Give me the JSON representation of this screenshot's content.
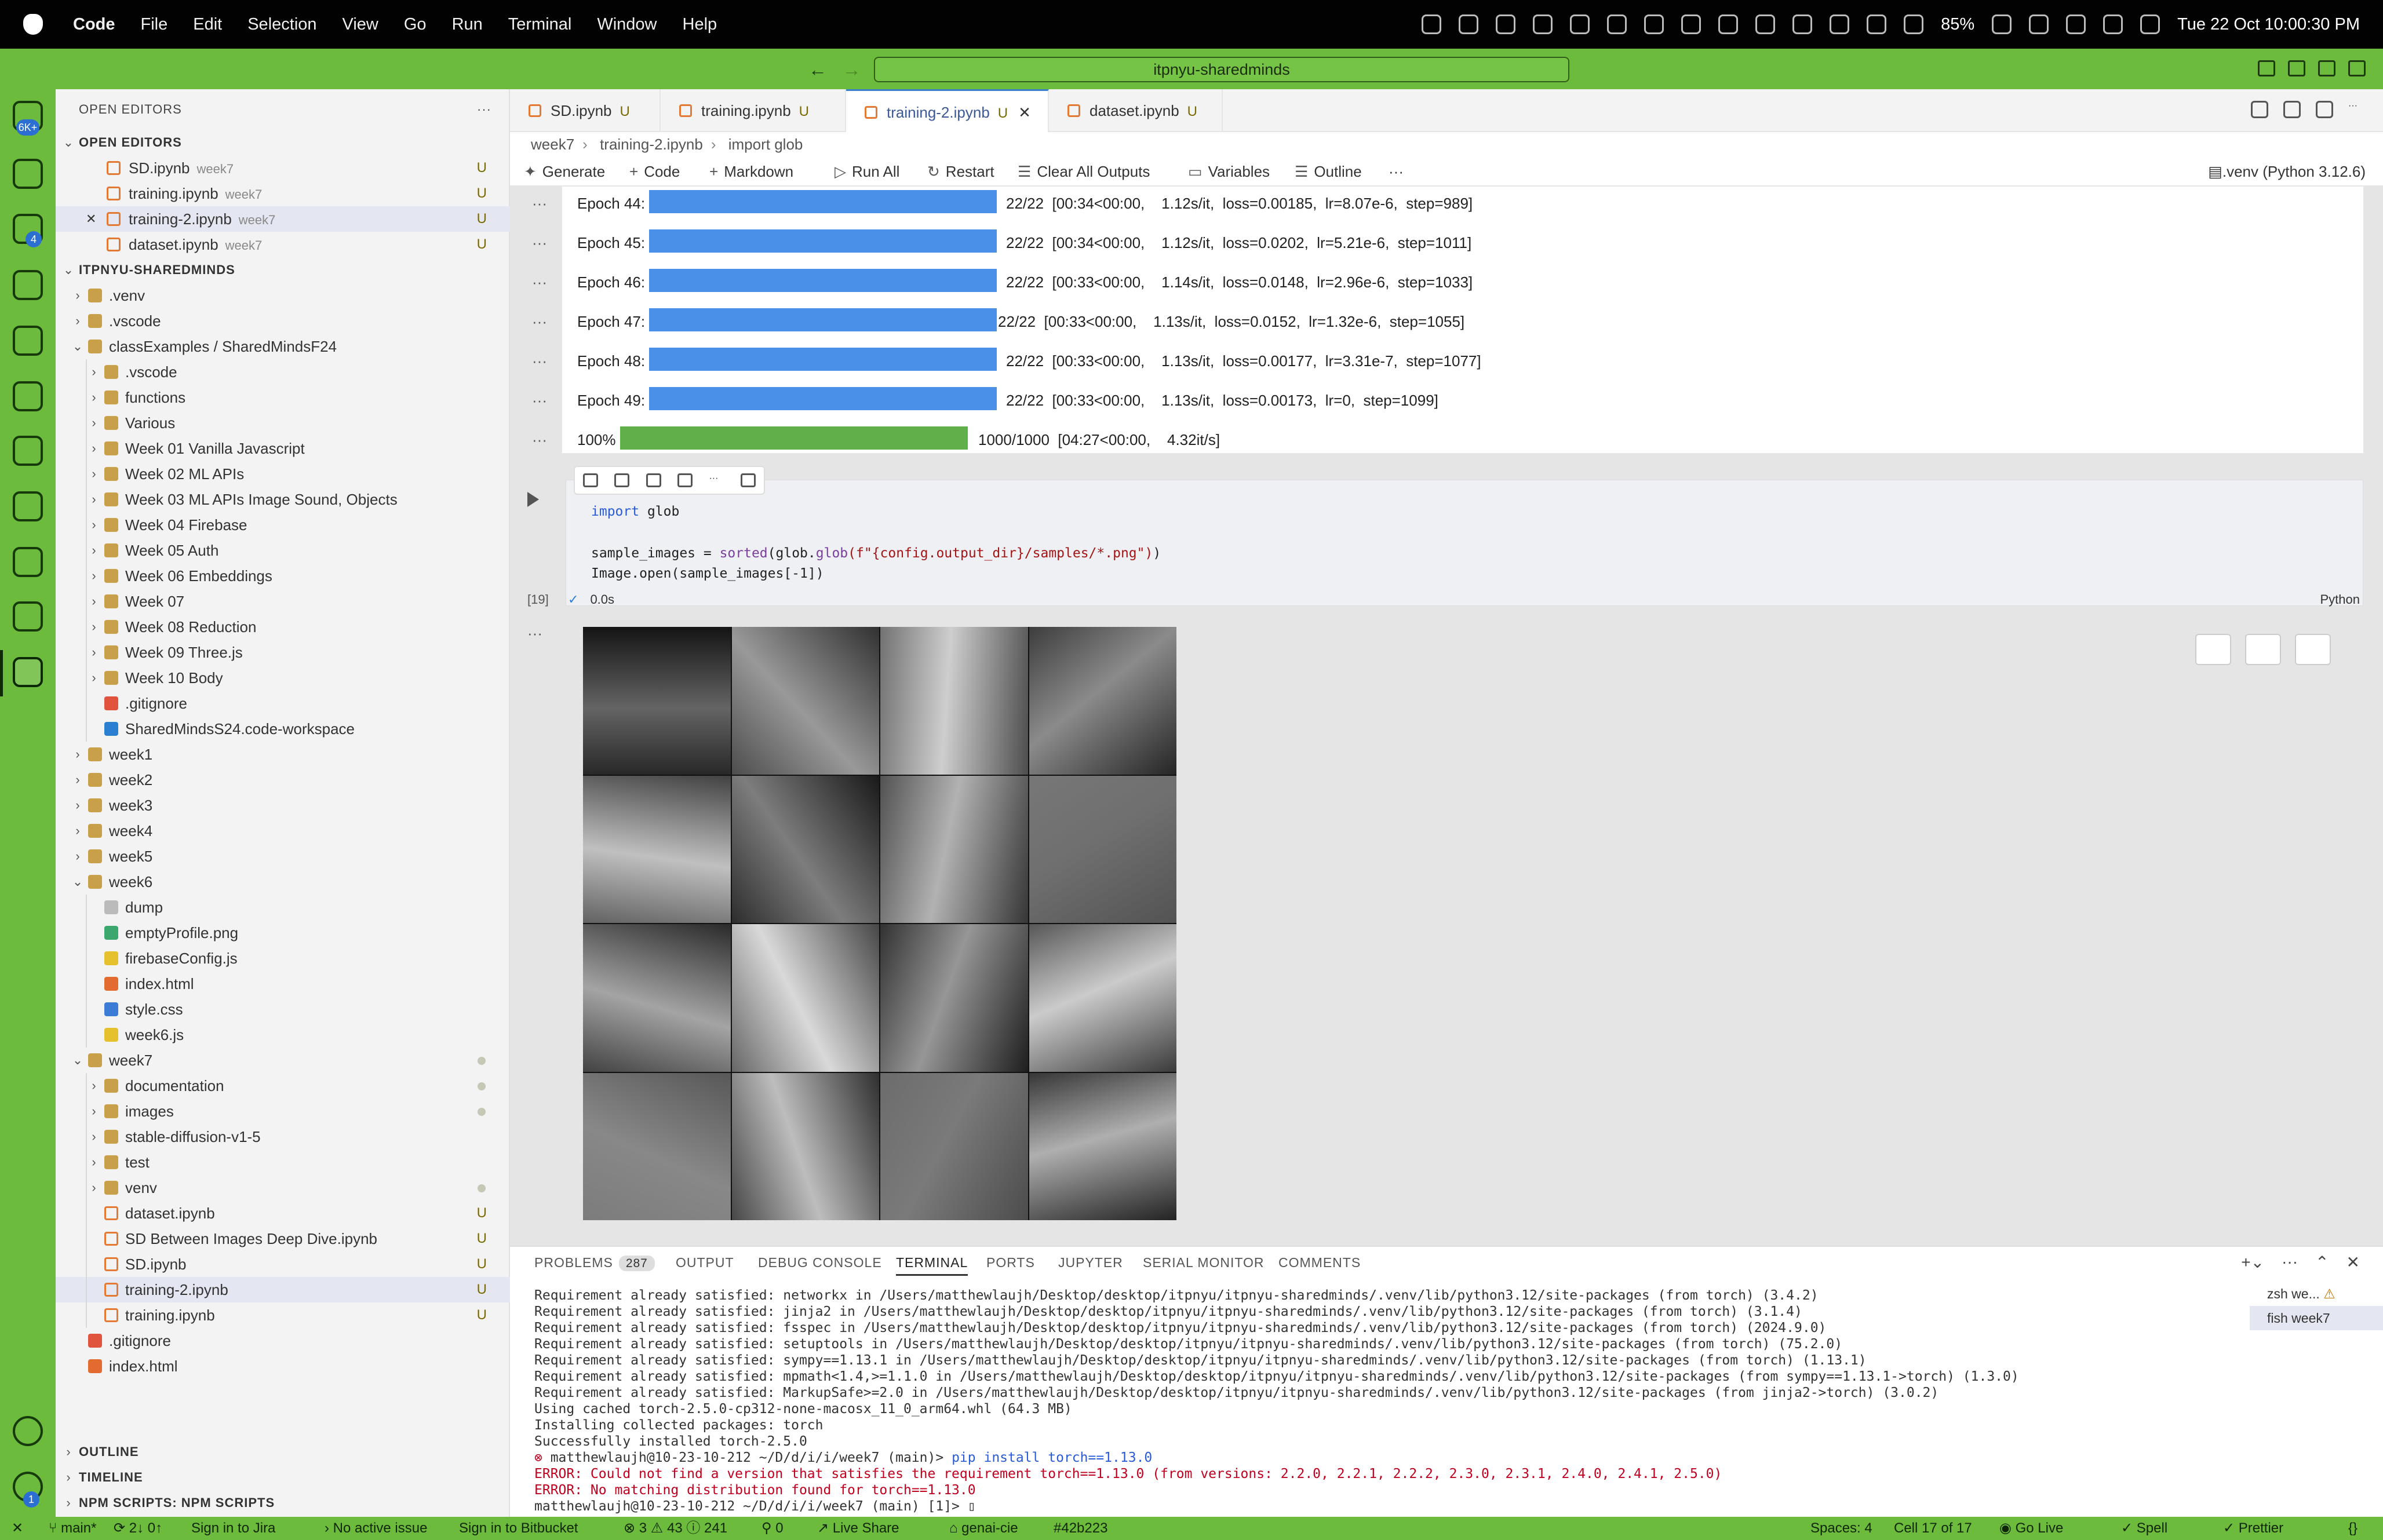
{
  "menubar": {
    "app": "Code",
    "items": [
      "File",
      "Edit",
      "Selection",
      "View",
      "Go",
      "Run",
      "Terminal",
      "Window",
      "Help"
    ],
    "battery": "85%",
    "datetime": "Tue 22 Oct  10:00:30 PM"
  },
  "titlebar": {
    "command_center": "itpnyu-sharedminds"
  },
  "activity": {
    "badge_accounts": "6K+",
    "badge_extensions": "4",
    "badge_settings": "1"
  },
  "sidebar": {
    "header": "OPEN EDITORS",
    "open_editors_title": "OPEN EDITORS",
    "open_editors": [
      {
        "name": "SD.ipynb",
        "desc": "week7",
        "status": "U"
      },
      {
        "name": "training.ipynb",
        "desc": "week7",
        "status": "U"
      },
      {
        "name": "training-2.ipynb",
        "desc": "week7",
        "status": "U"
      },
      {
        "name": "dataset.ipynb",
        "desc": "week7",
        "status": "U"
      }
    ],
    "root": "ITPNYU-SHAREDMINDS",
    "tree": [
      {
        "name": ".venv",
        "level": 1,
        "type": "folder"
      },
      {
        "name": ".vscode",
        "level": 1,
        "type": "folder"
      },
      {
        "name": "classExamples / SharedMindsF24",
        "level": 1,
        "type": "folder-open"
      },
      {
        "name": ".vscode",
        "level": 2,
        "type": "folder"
      },
      {
        "name": "functions",
        "level": 2,
        "type": "folder"
      },
      {
        "name": "Various",
        "level": 2,
        "type": "folder"
      },
      {
        "name": "Week 01  Vanilla Javascript",
        "level": 2,
        "type": "folder"
      },
      {
        "name": "Week 02 ML APIs",
        "level": 2,
        "type": "folder"
      },
      {
        "name": "Week 03 ML APIs Image Sound, Objects",
        "level": 2,
        "type": "folder"
      },
      {
        "name": "Week 04 Firebase",
        "level": 2,
        "type": "folder"
      },
      {
        "name": "Week 05 Auth",
        "level": 2,
        "type": "folder"
      },
      {
        "name": "Week 06 Embeddings",
        "level": 2,
        "type": "folder"
      },
      {
        "name": "Week 07",
        "level": 2,
        "type": "folder"
      },
      {
        "name": "Week 08 Reduction",
        "level": 2,
        "type": "folder"
      },
      {
        "name": "Week 09 Three.js",
        "level": 2,
        "type": "folder"
      },
      {
        "name": "Week 10 Body",
        "level": 2,
        "type": "folder"
      },
      {
        "name": ".gitignore",
        "level": 2,
        "type": "git"
      },
      {
        "name": "SharedMindsS24.code-workspace",
        "level": 2,
        "type": "vscode"
      },
      {
        "name": "week1",
        "level": 1,
        "type": "folder"
      },
      {
        "name": "week2",
        "level": 1,
        "type": "folder"
      },
      {
        "name": "week3",
        "level": 1,
        "type": "folder"
      },
      {
        "name": "week4",
        "level": 1,
        "type": "folder"
      },
      {
        "name": "week5",
        "level": 1,
        "type": "folder"
      },
      {
        "name": "week6",
        "level": 1,
        "type": "folder-open"
      },
      {
        "name": "dump",
        "level": 2,
        "type": "file"
      },
      {
        "name": "emptyProfile.png",
        "level": 2,
        "type": "image"
      },
      {
        "name": "firebaseConfig.js",
        "level": 2,
        "type": "js"
      },
      {
        "name": "index.html",
        "level": 2,
        "type": "html"
      },
      {
        "name": "style.css",
        "level": 2,
        "type": "css"
      },
      {
        "name": "week6.js",
        "level": 2,
        "type": "js"
      },
      {
        "name": "week7",
        "level": 1,
        "type": "folder-open"
      },
      {
        "name": "documentation",
        "level": 2,
        "type": "folder"
      },
      {
        "name": "images",
        "level": 2,
        "type": "folder"
      },
      {
        "name": "stable-diffusion-v1-5",
        "level": 2,
        "type": "folder"
      },
      {
        "name": "test",
        "level": 2,
        "type": "folder"
      },
      {
        "name": "venv",
        "level": 2,
        "type": "folder"
      },
      {
        "name": "dataset.ipynb",
        "level": 2,
        "type": "nb",
        "status": "U"
      },
      {
        "name": "SD Between Images Deep Dive.ipynb",
        "level": 2,
        "type": "nb",
        "status": "U"
      },
      {
        "name": "SD.ipynb",
        "level": 2,
        "type": "nb",
        "status": "U"
      },
      {
        "name": "training-2.ipynb",
        "level": 2,
        "type": "nb",
        "status": "U"
      },
      {
        "name": "training.ipynb",
        "level": 2,
        "type": "nb",
        "status": "U"
      },
      {
        "name": ".gitignore",
        "level": 1,
        "type": "git"
      },
      {
        "name": "index.html",
        "level": 1,
        "type": "html"
      }
    ],
    "outline": "OUTLINE",
    "timeline": "TIMELINE",
    "npm": "NPM SCRIPTS: NPM SCRIPTS"
  },
  "tabs": [
    {
      "name": "SD.ipynb",
      "status": "U"
    },
    {
      "name": "training.ipynb",
      "status": "U"
    },
    {
      "name": "training-2.ipynb",
      "status": "U"
    },
    {
      "name": "dataset.ipynb",
      "status": "U"
    }
  ],
  "breadcrumb": {
    "a": "week7",
    "b": "training-2.ipynb",
    "c": "import glob"
  },
  "nbtoolbar": {
    "generate": "Generate",
    "code": "Code",
    "markdown": "Markdown",
    "run_all": "Run All",
    "restart": "Restart",
    "clear": "Clear All Outputs",
    "variables": "Variables",
    "outline": "Outline",
    "kernel": ".venv (Python 3.12.6)"
  },
  "progress": [
    {
      "label": "Epoch  44:  100%",
      "fraction": 1.0,
      "stat": "22/22  [00:34<00:00,    1.12s/it,  loss=0.00185,  lr=8.07e-6,  step=989]"
    },
    {
      "label": "Epoch  45:  100%",
      "fraction": 1.0,
      "stat": "22/22  [00:34<00:00,    1.12s/it,  loss=0.0202,  lr=5.21e-6,  step=1011]"
    },
    {
      "label": "Epoch  46:  100%",
      "fraction": 1.0,
      "stat": "22/22  [00:33<00:00,    1.14s/it,  loss=0.0148,  lr=2.96e-6,  step=1033]"
    },
    {
      "label": "Epoch  47:  100%",
      "fraction": 1.0,
      "stat": "22/22  [00:33<00:00,    1.13s/it,  loss=0.0152,  lr=1.32e-6,  step=1055]"
    },
    {
      "label": "Epoch  48:  100%",
      "fraction": 1.0,
      "stat": "22/22  [00:33<00:00,    1.13s/it,  loss=0.00177,  lr=3.31e-7,  step=1077]"
    },
    {
      "label": "Epoch  49:  100%",
      "fraction": 1.0,
      "stat": "22/22  [00:33<00:00,    1.13s/it,  loss=0.00173,  lr=0,  step=1099]"
    }
  ],
  "overall": {
    "label": "100%",
    "fraction": 1.0,
    "stat": "1000/1000  [04:27<00:00,    4.32it/s]"
  },
  "colors": {
    "epoch_bar": "#4a90e8",
    "overall_bar": "#5fb04a",
    "accent": "#6cbb3c"
  },
  "cell": {
    "line1_kw": "import",
    "line1_rest": " glob",
    "line2_var": "sample_images = ",
    "line2_fn1": "sorted",
    "line2_mid": "(glob.",
    "line2_fn2": "glob",
    "line2_str": "(f\"{config.output_dir}/samples/*.png\")",
    "line2_end": ")",
    "line3": "Image.open(sample_images[-1])",
    "count": "[19]",
    "time": "0.0s",
    "lang": "Python"
  },
  "panel": {
    "tabs": [
      {
        "name": "PROBLEMS",
        "badge": "287"
      },
      {
        "name": "OUTPUT"
      },
      {
        "name": "DEBUG CONSOLE"
      },
      {
        "name": "TERMINAL"
      },
      {
        "name": "PORTS"
      },
      {
        "name": "JUPYTER"
      },
      {
        "name": "SERIAL MONITOR"
      },
      {
        "name": "COMMENTS"
      }
    ],
    "terminal_lines": [
      "Requirement already satisfied: networkx in /Users/matthewlaujh/Desktop/desktop/itpnyu/itpnyu-sharedminds/.venv/lib/python3.12/site-packages (from torch) (3.4.2)",
      "Requirement already satisfied: jinja2 in /Users/matthewlaujh/Desktop/desktop/itpnyu/itpnyu-sharedminds/.venv/lib/python3.12/site-packages (from torch) (3.1.4)",
      "Requirement already satisfied: fsspec in /Users/matthewlaujh/Desktop/desktop/itpnyu/itpnyu-sharedminds/.venv/lib/python3.12/site-packages (from torch) (2024.9.0)",
      "Requirement already satisfied: setuptools in /Users/matthewlaujh/Desktop/desktop/itpnyu/itpnyu-sharedminds/.venv/lib/python3.12/site-packages (from torch) (75.2.0)",
      "Requirement already satisfied: sympy==1.13.1 in /Users/matthewlaujh/Desktop/desktop/itpnyu/itpnyu-sharedminds/.venv/lib/python3.12/site-packages (from torch) (1.13.1)",
      "Requirement already satisfied: mpmath<1.4,>=1.1.0 in /Users/matthewlaujh/Desktop/desktop/itpnyu/itpnyu-sharedminds/.venv/lib/python3.12/site-packages (from sympy==1.13.1->torch) (1.3.0)",
      "Requirement already satisfied: MarkupSafe>=2.0 in /Users/matthewlaujh/Desktop/desktop/itpnyu/itpnyu-sharedminds/.venv/lib/python3.12/site-packages (from jinja2->torch) (3.0.2)",
      "Using cached torch-2.5.0-cp312-none-macosx_11_0_arm64.whl (64.3 MB)",
      "Installing collected packages: torch",
      "Successfully installed torch-2.5.0"
    ],
    "prompt1": "matthewlaujh@10-23-10-212 ~/D/d/i/i/week7 (main)>",
    "cmd1": "pip install torch==1.13.0",
    "err1": "ERROR: Could not find a version that satisfies the requirement torch==1.13.0 (from versions: 2.2.0, 2.2.1, 2.2.2, 2.3.0, 2.3.1, 2.4.0, 2.4.1, 2.5.0)",
    "err2": "ERROR: No matching distribution found for torch==1.13.0",
    "prompt2": "matthewlaujh@10-23-10-212 ~/D/d/i/i/week7 (main) [1]>",
    "terms": [
      {
        "name": "zsh  we..."
      },
      {
        "name": "fish  week7"
      }
    ]
  },
  "statusbar": {
    "close": "✕",
    "branch": "main*",
    "sync": "2↓ 0↑",
    "jira": "Sign in to Jira",
    "issue": "No active issue",
    "bitbucket": "Sign in to Bitbucket",
    "problems": "⊗ 3  ⚠ 43  ⓘ 241",
    "ports": "0",
    "liveshare": "Live Share",
    "genai": "genai-cie",
    "hash": "#42b223",
    "spaces": "Spaces: 4",
    "cell": "Cell 17 of 17",
    "golive": "Go Live",
    "spell": "Spell",
    "prettier": "Prettier"
  }
}
